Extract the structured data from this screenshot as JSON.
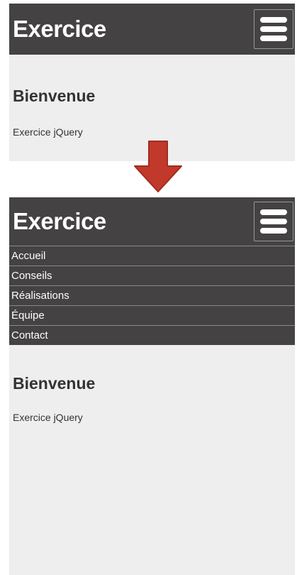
{
  "before": {
    "brand": "Exercice",
    "heading": "Bienvenue",
    "text": "Exercice jQuery"
  },
  "after": {
    "brand": "Exercice",
    "menu": [
      {
        "label": "Accueil"
      },
      {
        "label": "Conseils"
      },
      {
        "label": "Réalisations"
      },
      {
        "label": "Équipe"
      },
      {
        "label": "Contact"
      }
    ],
    "heading": "Bienvenue",
    "text": "Exercice jQuery"
  },
  "icons": {
    "menu": "hamburger-icon",
    "transition": "arrow-down-icon"
  },
  "colors": {
    "header_bg": "#444242",
    "content_bg": "#eeeeee",
    "arrow_fill": "#c0392b"
  }
}
